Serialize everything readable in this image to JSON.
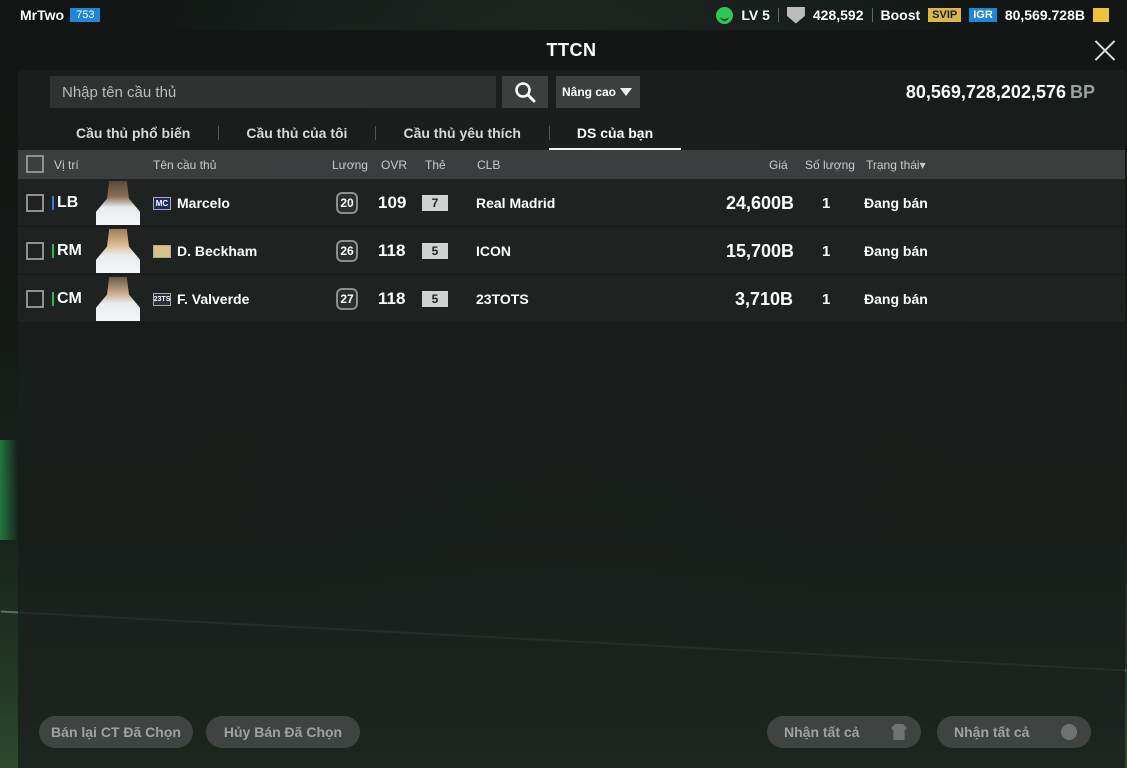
{
  "topbar": {
    "username": "MrTwo",
    "user_badge": "753",
    "level": "LV 5",
    "team_value": "428,592",
    "boost_label": "Boost",
    "svip_label": "SVIP",
    "igr_label": "IGR",
    "currency": "80,569.728B"
  },
  "panel": {
    "title": "TTCN",
    "search_placeholder": "Nhập tên cầu thủ",
    "advanced_label": "Nâng cao",
    "balance_value": "80,569,728,202,576",
    "balance_unit": "BP"
  },
  "tabs": [
    {
      "label": "Cầu thủ phổ biến"
    },
    {
      "label": "Cầu thủ của tôi"
    },
    {
      "label": "Cầu thủ yêu thích"
    },
    {
      "label": "DS của bạn"
    }
  ],
  "table": {
    "headers": {
      "position": "Vị trí",
      "name": "Tên cầu thủ",
      "salary": "Lương",
      "ovr": "OVR",
      "card": "Thẻ",
      "club": "CLB",
      "price": "Giá",
      "quantity": "Số lượng",
      "status": "Trạng thái▾"
    },
    "rows": [
      {
        "position": "LB",
        "pos_color": "#2f7fe0",
        "season": "MC",
        "name": "Marcelo",
        "salary": "20",
        "ovr": "109",
        "card": "7",
        "club": "Real Madrid",
        "price": "24,600B",
        "quantity": "1",
        "status": "Đang bán"
      },
      {
        "position": "RM",
        "pos_color": "#38b24a",
        "season": "",
        "name": "D. Beckham",
        "salary": "26",
        "ovr": "118",
        "card": "5",
        "club": "ICON",
        "price": "15,700B",
        "quantity": "1",
        "status": "Đang bán"
      },
      {
        "position": "CM",
        "pos_color": "#38b24a",
        "season": "23TS",
        "name": "F. Valverde",
        "salary": "27",
        "ovr": "118",
        "card": "5",
        "club": "23TOTS",
        "price": "3,710B",
        "quantity": "1",
        "status": "Đang bán"
      }
    ]
  },
  "bottom": {
    "resell_label": "Bán lại CT Đã Chọn",
    "cancel_label": "Hủy Bán Đã Chọn",
    "receive_all_1": "Nhận tất cả",
    "receive_all_2": "Nhận tất cả"
  }
}
